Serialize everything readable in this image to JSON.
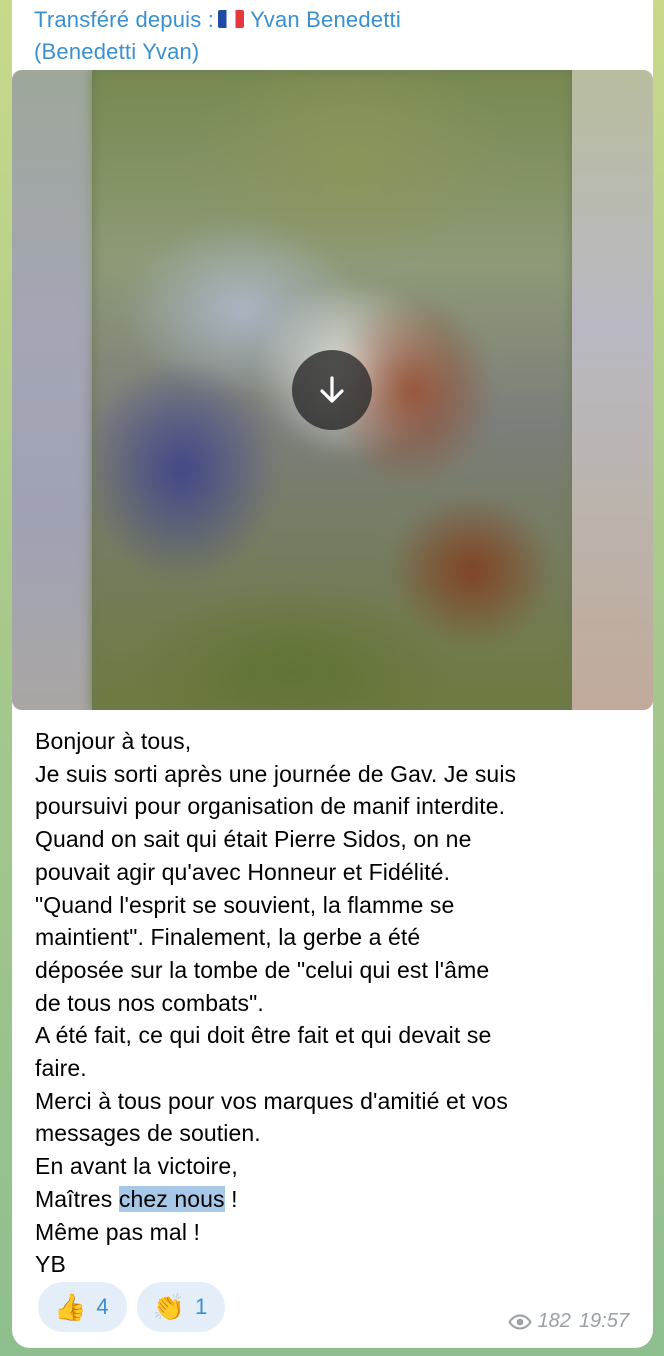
{
  "forward": {
    "prefix": "Transféré depuis :",
    "flag_icon": "french-flag-icon",
    "name_line1": "Yvan Benedetti",
    "name_line2": "(Benedetti Yvan)"
  },
  "media": {
    "download_icon": "arrow-down-icon"
  },
  "message": {
    "lines": [
      "Bonjour à tous,",
      "Je suis sorti après une journée de Gav. Je suis",
      "poursuivi pour organisation de manif interdite.",
      "Quand on sait qui était Pierre Sidos, on ne",
      "pouvait agir qu'avec Honneur et Fidélité.",
      "\"Quand l'esprit se souvient, la flamme se",
      "maintient\". Finalement, la gerbe a été",
      "déposée sur la tombe de \"celui qui est l'âme",
      "de tous nos combats\".",
      "A été fait, ce qui doit être fait et qui devait se",
      "faire.",
      "Merci à tous pour vos marques d'amitié et vos",
      "messages de soutien.",
      "En avant la victoire,"
    ],
    "line_maitres_prefix": "Maîtres ",
    "line_maitres_highlight": "chez nous",
    "line_maitres_suffix": " !",
    "line_meme": "Même pas mal !",
    "signature": "YB"
  },
  "reactions": [
    {
      "emoji": "👍",
      "icon": "thumbs-up-icon",
      "count": "4"
    },
    {
      "emoji": "👏",
      "icon": "clapping-hands-icon",
      "count": "1"
    }
  ],
  "meta": {
    "views": "182",
    "time": "19:57",
    "views_icon": "eye-icon"
  },
  "colors": {
    "link": "#3a8fd0",
    "highlight": "#a8c8e8",
    "reaction_bg": "#e3eef9"
  }
}
